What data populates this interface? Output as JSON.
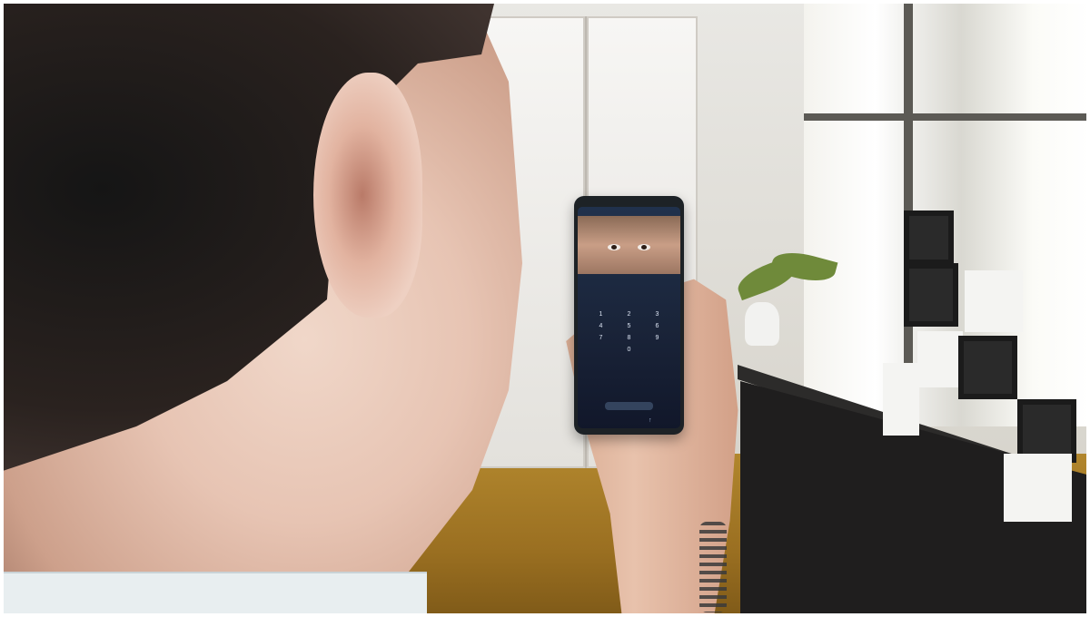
{
  "photo": {
    "subject": "",
    "phone_screen": {
      "status_bar": "",
      "prompt": "",
      "keypad_keys": [
        "1",
        "2",
        "3",
        "4",
        "5",
        "6",
        "7",
        "8",
        "9",
        "",
        "0",
        ""
      ],
      "emergency_label": "",
      "back_arrow": "↑"
    }
  }
}
